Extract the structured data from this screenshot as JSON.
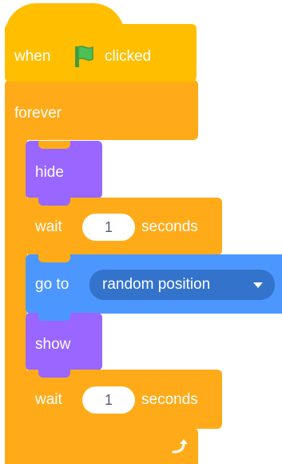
{
  "colors": {
    "events": "#FFBF00",
    "events_dark": "#E6A800",
    "control": "#FFAB19",
    "control_dark": "#CF8B17",
    "looks": "#9966FF",
    "motion": "#4C97FF",
    "motion_dark": "#3373CC",
    "flag": "#4CBF56"
  },
  "script": {
    "hat": {
      "when": "when",
      "clicked": "clicked",
      "icon": "green-flag-icon"
    },
    "forever": {
      "label": "forever",
      "loop_icon": "loop-arrow-icon"
    },
    "hide": {
      "label": "hide"
    },
    "wait1": {
      "wait": "wait",
      "value": "1",
      "unit": "seconds"
    },
    "goto": {
      "label": "go to",
      "target": "random position"
    },
    "show": {
      "label": "show"
    },
    "wait2": {
      "wait": "wait",
      "value": "1",
      "unit": "seconds"
    }
  }
}
